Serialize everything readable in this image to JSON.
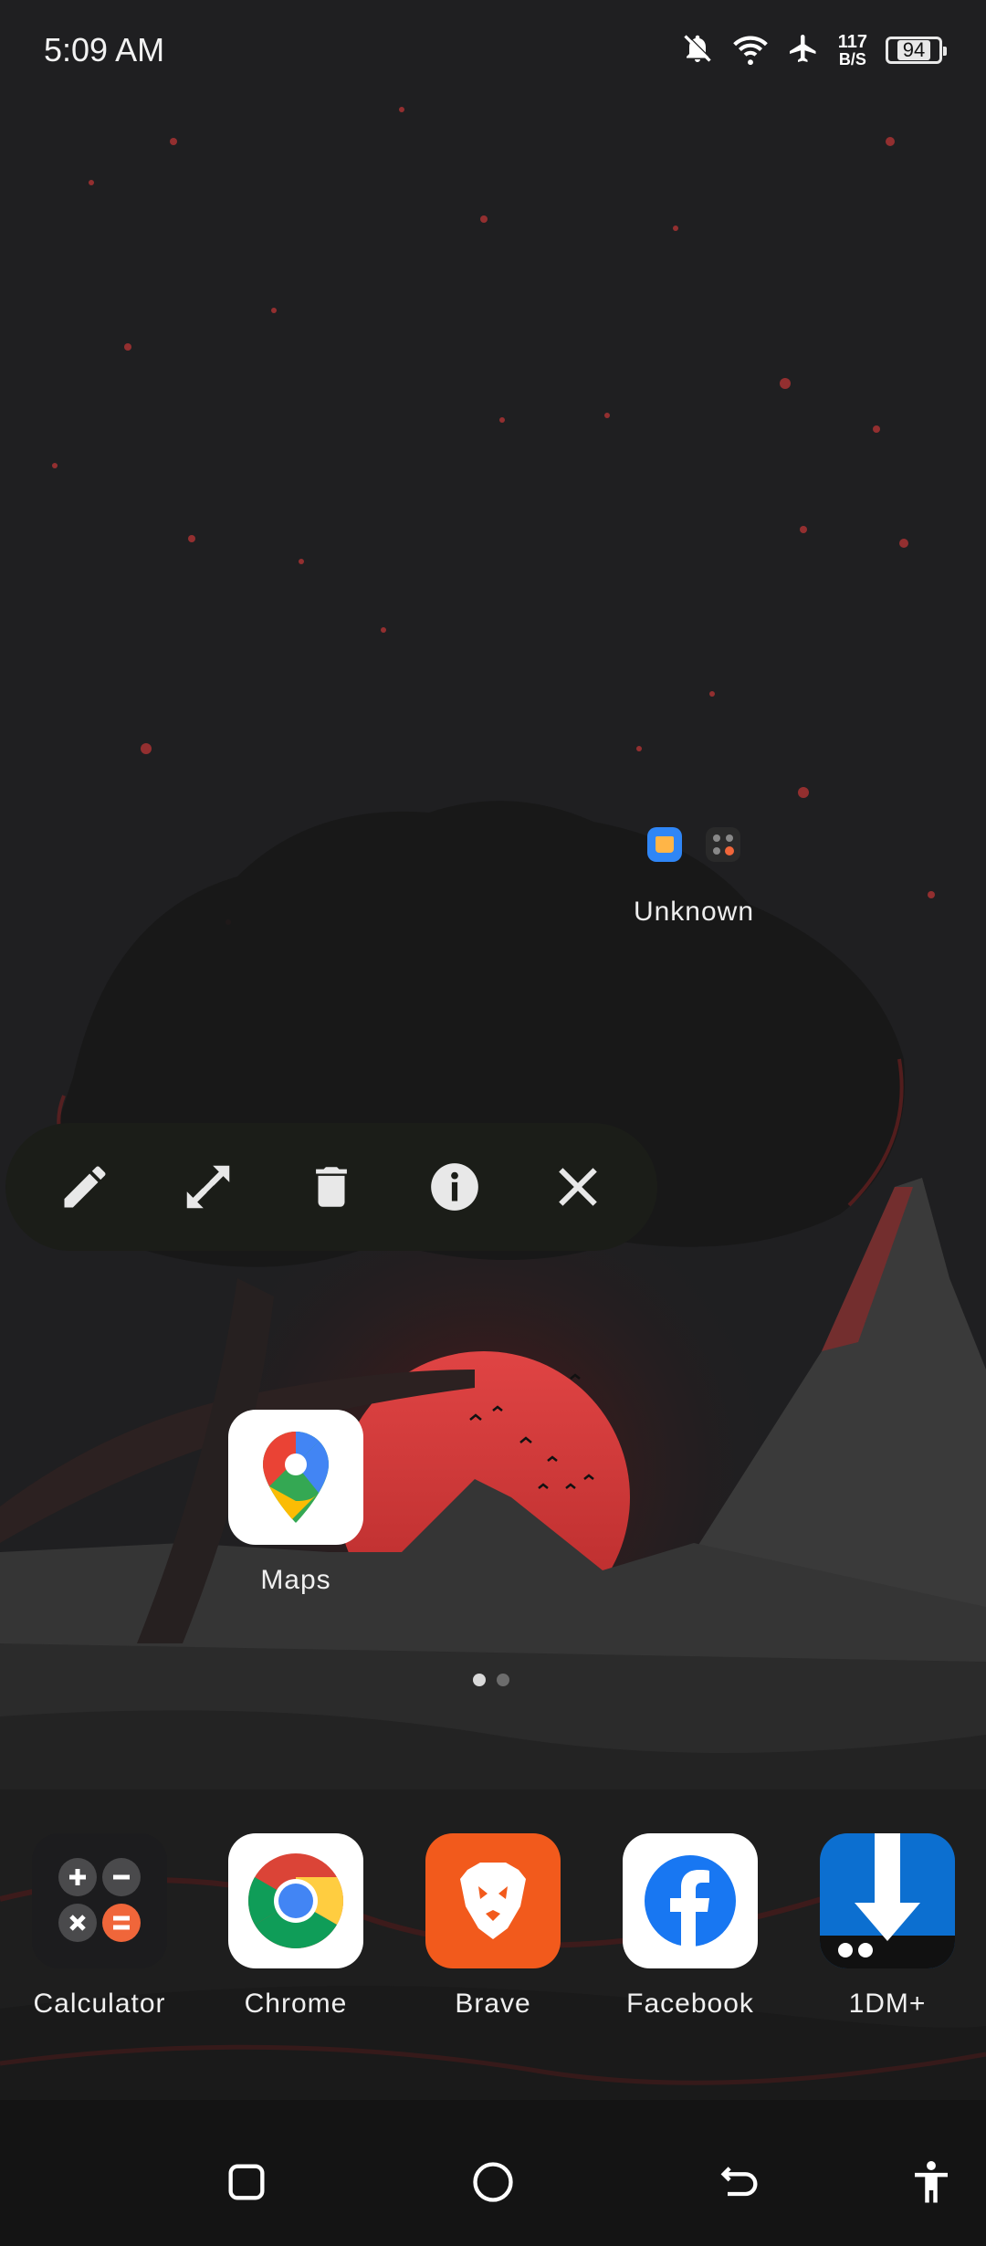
{
  "status_bar": {
    "time": "5:09 AM",
    "net_speed_value": "117",
    "net_speed_unit": "B/S",
    "battery_level": "94",
    "icons": [
      "bell-off-icon",
      "wifi-icon",
      "airplane-icon"
    ]
  },
  "folder": {
    "label": "Unknown",
    "preview_icons": [
      "home-app-icon",
      "calculator-mini-icon"
    ]
  },
  "action_bar": {
    "actions": [
      "edit-icon",
      "resize-icon",
      "delete-icon",
      "info-icon",
      "close-icon"
    ]
  },
  "apps": {
    "maps": "Maps"
  },
  "dock": {
    "items": [
      "Calculator",
      "Chrome",
      "Brave",
      "Facebook",
      "1DM+"
    ]
  },
  "pages": {
    "count": 2,
    "active": 1
  },
  "nav_bar": {
    "buttons": [
      "recents-icon",
      "home-icon",
      "back-icon",
      "accessibility-icon"
    ]
  },
  "colors": {
    "background": "#1f1f21",
    "moon": "#d93b3b",
    "action_bar": "#1b1d18",
    "brave": "#f25a1c",
    "facebook": "#1877f2",
    "onedm": "#0c6fd0"
  }
}
